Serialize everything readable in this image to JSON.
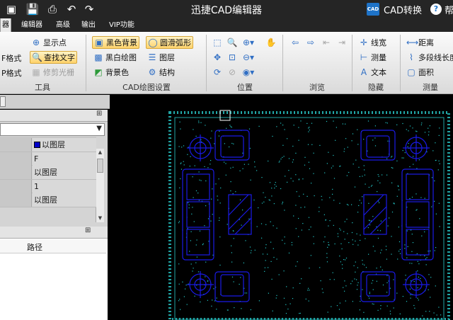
{
  "title_bar": {
    "app_title": "迅捷CAD编辑器",
    "cad_convert_logo": "CAD",
    "cad_convert_label": "CAD转换",
    "help_label": "帮",
    "quick_access": [
      "open-folder-icon",
      "save-icon",
      "print-icon",
      "undo-icon",
      "redo-icon"
    ]
  },
  "menu_tabs": [
    {
      "label": "器",
      "active": true
    },
    {
      "label": "编辑器",
      "active": false
    },
    {
      "label": "高级",
      "active": false
    },
    {
      "label": "输出",
      "active": false
    },
    {
      "label": "VIP功能",
      "active": false
    }
  ],
  "ribbon": {
    "tools": {
      "format1": "F格式",
      "format2": "P格式",
      "show_point": "显示点",
      "find_text": "查找文字",
      "trim_raster": "修剪光栅",
      "label": "工具"
    },
    "cad_settings": {
      "black_bg": "黑色背景",
      "bw_drawing": "黑白绘图",
      "bg_color": "背景色",
      "smooth_arc": "圆滑弧形",
      "layers": "图层",
      "structure": "结构",
      "label": "CAD绘图设置"
    },
    "position": {
      "label": "位置"
    },
    "browse": {
      "label": "浏览"
    },
    "hide": {
      "line_width": "线宽",
      "measure": "测量",
      "text": "文本",
      "label": "隐藏"
    },
    "measure": {
      "distance": "距离",
      "polyline": "多段线长度",
      "area": "面积",
      "label": "测量"
    }
  },
  "properties_panel": {
    "pin": "⊞",
    "rows": [
      {
        "value": "以图层",
        "swatch": "#0000c8"
      },
      {
        "value": "F"
      },
      {
        "value": "以图层"
      },
      {
        "value": "1"
      },
      {
        "value": "以图层"
      }
    ]
  },
  "files_panel": {
    "pin": "⊞",
    "column_path": "路径"
  },
  "drawing": {
    "background": "#000000",
    "line_color": "#1a1ae6",
    "dot_color": "#22c6c6",
    "border_color": "#21a5a5"
  }
}
